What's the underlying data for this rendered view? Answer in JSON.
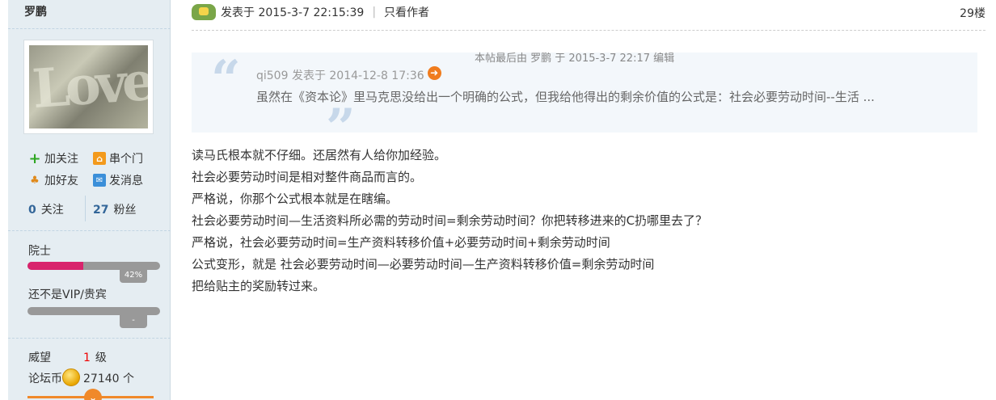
{
  "sidebar": {
    "author_name": "罗鹏",
    "avatar_text": "Love",
    "actions": {
      "follow": "加关注",
      "visit": "串个门",
      "add_friend": "加好友",
      "message": "发消息"
    },
    "stats": {
      "following_count": "0",
      "following_label": "关注",
      "followers_count": "27",
      "followers_label": "粉丝"
    },
    "rank": {
      "title": "院士",
      "progress_percent": 42,
      "progress_label": "42%"
    },
    "vip": {
      "title": "还不是VIP/贵宾",
      "progress_label": "-"
    },
    "prestige": {
      "label": "威望",
      "value": "1",
      "unit": "级"
    },
    "coins": {
      "label": "论坛币",
      "value": "27140",
      "unit": "个"
    }
  },
  "post": {
    "posted_label": "发表于 2015-3-7 22:15:39",
    "separator": "|",
    "only_author": "只看作者",
    "floor": "29楼",
    "edit_note": "本帖最后由 罗鹏 于 2015-3-7 22:17 编辑",
    "quote": {
      "meta": "qi509 发表于 2014-12-8 17:36",
      "text": "虽然在《资本论》里马克思没给出一个明确的公式，但我给他得出的剩余价值的公式是：社会必要劳动时间--生活 ..."
    },
    "body_lines": [
      "读马氏根本就不仔细。还居然有人给你加经验。",
      "社会必要劳动时间是相对整件商品而言的。",
      "严格说，你那个公式根本就是在瞎编。",
      "社会必要劳动时间—生活资料所必需的劳动时间=剩余劳动时间？你把转移进来的C扔哪里去了？",
      "严格说，社会必要劳动时间=生产资料转移价值+必要劳动时间+剩余劳动时间",
      "公式变形，就是  社会必要劳动时间—必要劳动时间—生产资料转移价值=剩余劳动时间",
      "把给贴主的奖励转过来。"
    ]
  },
  "colors": {
    "sidebar_bg": "#e5edf2",
    "rank_bar": "#d8246c",
    "quote_bg": "#f3f7fb",
    "link_blue": "#336699"
  }
}
